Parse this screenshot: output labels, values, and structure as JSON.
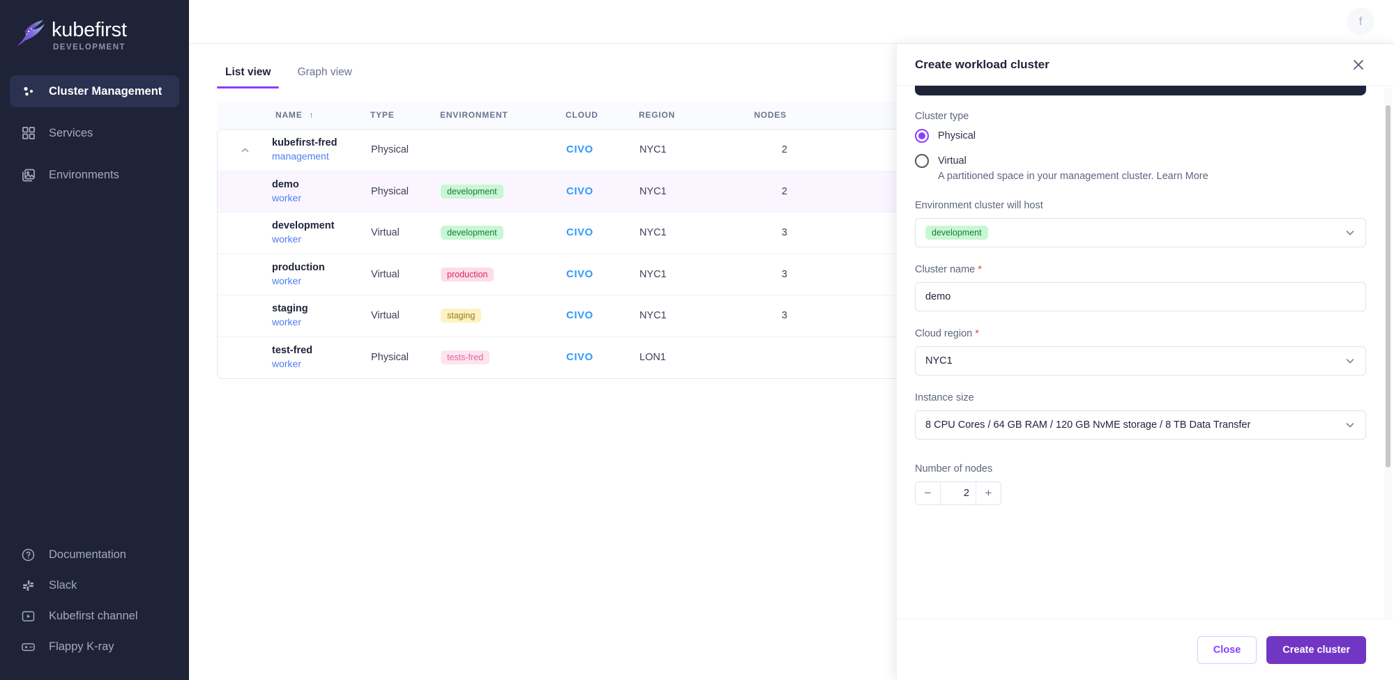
{
  "brand": {
    "name": "kubefirst",
    "sub": "DEVELOPMENT"
  },
  "sidebar": {
    "nav": [
      {
        "label": "Cluster Management",
        "icon": "cluster-icon",
        "active": true
      },
      {
        "label": "Services",
        "icon": "grid-icon",
        "active": false
      },
      {
        "label": "Environments",
        "icon": "images-icon",
        "active": false
      }
    ],
    "footer": [
      {
        "label": "Documentation",
        "icon": "help-circle-icon"
      },
      {
        "label": "Slack",
        "icon": "slack-icon"
      },
      {
        "label": "Kubefirst channel",
        "icon": "youtube-icon"
      },
      {
        "label": "Flappy K-ray",
        "icon": "gamepad-icon"
      }
    ]
  },
  "topbar": {
    "avatar_initial": "f"
  },
  "tabs": [
    {
      "label": "List view",
      "active": true
    },
    {
      "label": "Graph view",
      "active": false
    }
  ],
  "table": {
    "columns": [
      "NAME",
      "TYPE",
      "ENVIRONMENT",
      "CLOUD",
      "REGION",
      "NODES"
    ],
    "sort_column": "NAME",
    "sort_direction": "asc",
    "rows": [
      {
        "name": "kubefirst-fred",
        "role": "management",
        "type": "Physical",
        "environment": "",
        "env_class": "",
        "cloud": "CIVO",
        "region": "NYC1",
        "nodes": "2",
        "expander": "chevron-up",
        "highlight": false
      },
      {
        "name": "demo",
        "role": "worker",
        "type": "Physical",
        "environment": "development",
        "env_class": "development",
        "cloud": "CIVO",
        "region": "NYC1",
        "nodes": "2",
        "expander": "",
        "highlight": true
      },
      {
        "name": "development",
        "role": "worker",
        "type": "Virtual",
        "environment": "development",
        "env_class": "development",
        "cloud": "CIVO",
        "region": "NYC1",
        "nodes": "3",
        "expander": "",
        "highlight": false
      },
      {
        "name": "production",
        "role": "worker",
        "type": "Virtual",
        "environment": "production",
        "env_class": "production",
        "cloud": "CIVO",
        "region": "NYC1",
        "nodes": "3",
        "expander": "",
        "highlight": false
      },
      {
        "name": "staging",
        "role": "worker",
        "type": "Virtual",
        "environment": "staging",
        "env_class": "staging",
        "cloud": "CIVO",
        "region": "NYC1",
        "nodes": "3",
        "expander": "",
        "highlight": false
      },
      {
        "name": "test-fred",
        "role": "worker",
        "type": "Physical",
        "environment": "tests-fred",
        "env_class": "tests-fred",
        "cloud": "CIVO",
        "region": "LON1",
        "nodes": "",
        "expander": "",
        "highlight": false
      }
    ]
  },
  "drawer": {
    "title": "Create workload cluster",
    "cluster_type": {
      "label": "Cluster type",
      "options": [
        {
          "label": "Physical",
          "selected": true
        },
        {
          "label": "Virtual",
          "selected": false
        }
      ],
      "hint": "A partitioned space in your management cluster. Learn More"
    },
    "environment": {
      "label": "Environment cluster will host",
      "value": "development"
    },
    "cluster_name": {
      "label": "Cluster name",
      "required": true,
      "value": "demo",
      "placeholder": "Cluster name"
    },
    "cloud_region": {
      "label": "Cloud region",
      "required": true,
      "value": "NYC1"
    },
    "instance_size": {
      "label": "Instance size",
      "value": "8 CPU Cores / 64 GB RAM / 120 GB NvME storage / 8 TB Data Transfer"
    },
    "nodes": {
      "label": "Number of nodes",
      "value": "2",
      "minus": "−",
      "plus": "+"
    },
    "footer": {
      "close": "Close",
      "create": "Create cluster"
    }
  },
  "colors": {
    "accent": "#8a3ffc",
    "primary_button": "#7236c4",
    "sidebar_bg": "#1e2338",
    "link": "#4f7df3",
    "civo": "#2f9bff"
  }
}
